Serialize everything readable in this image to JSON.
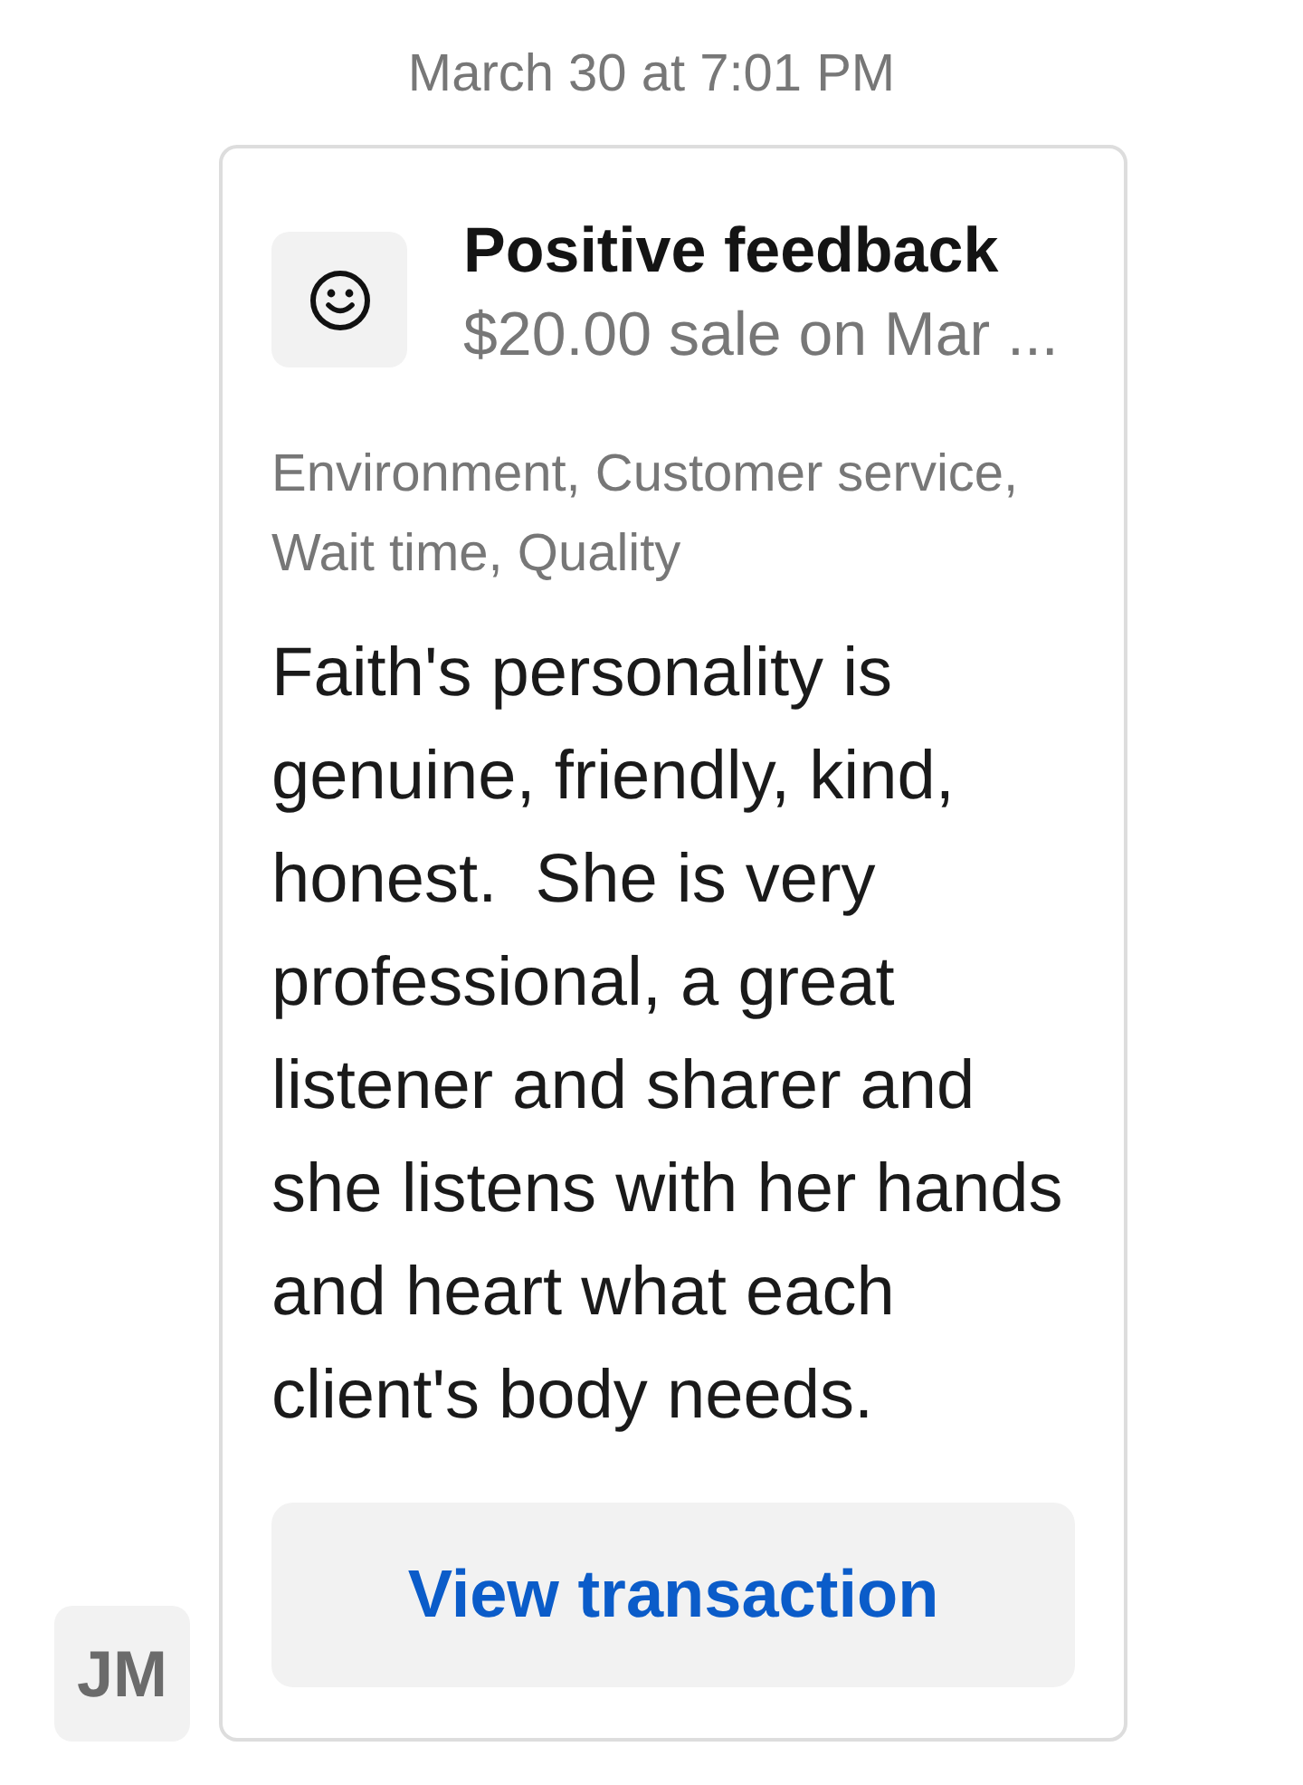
{
  "timestamp": "March 30 at 7:01 PM",
  "card": {
    "title": "Positive feedback",
    "subtitle": "$20.00 sale on Mar ...",
    "tags": "Environment, Customer service, Wait time, Quality",
    "comment": "Faith's personality is genuine, friendly, kind, honest.  She is very professional, a great listener and sharer and she listens with her hands and heart what each client's body needs.",
    "button": "View transaction"
  },
  "sender": {
    "initials": "JM"
  }
}
